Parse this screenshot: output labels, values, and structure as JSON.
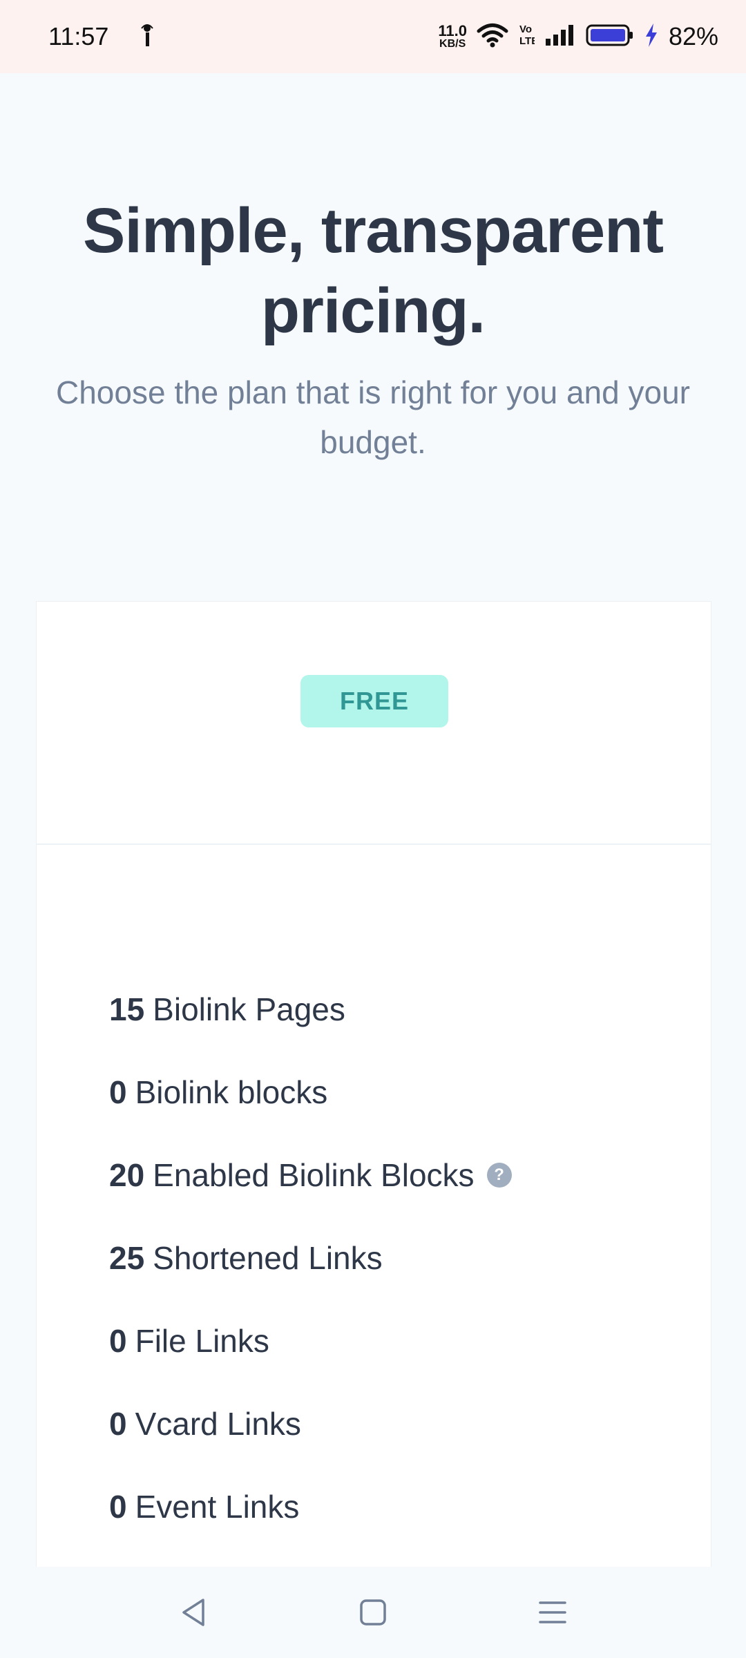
{
  "status_bar": {
    "time": "11:57",
    "net_speed_value": "11.0",
    "net_speed_unit": "KB/S",
    "battery_percent": "82%"
  },
  "hero": {
    "title": "Simple, transparent pricing.",
    "subtitle": "Choose the plan that is right for you and your budget."
  },
  "plan": {
    "badge": "FREE",
    "features": [
      {
        "count": "15",
        "label": "Biolink Pages"
      },
      {
        "count": "0",
        "label": "Biolink blocks"
      },
      {
        "count": "20",
        "label": "Enabled Biolink Blocks"
      },
      {
        "count": "25",
        "label": "Shortened Links"
      },
      {
        "count": "0",
        "label": "File Links"
      },
      {
        "count": "0",
        "label": "Vcard Links"
      },
      {
        "count": "0",
        "label": "Event Links"
      }
    ]
  },
  "colors": {
    "badge_bg": "#b2f5ea",
    "badge_text": "#319795",
    "battery_fill": "#3b3fd8"
  }
}
